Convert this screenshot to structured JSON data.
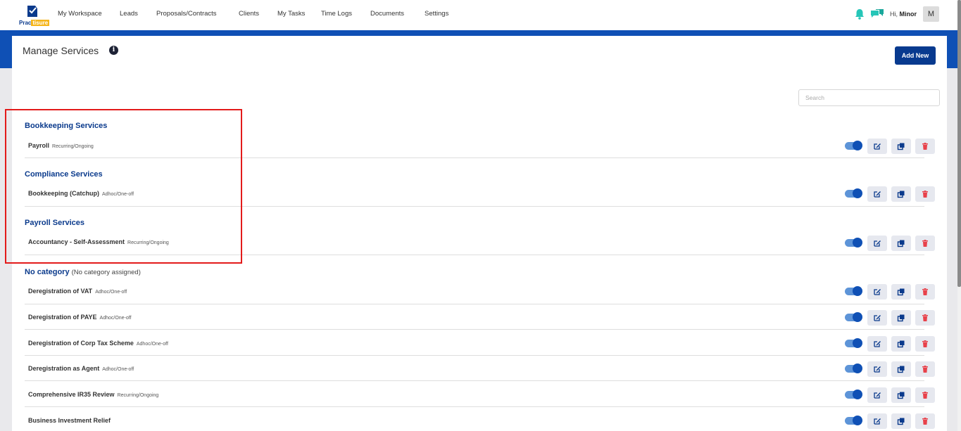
{
  "brand": {
    "logo_text_a": "Prac",
    "logo_text_b": "tisure"
  },
  "nav": {
    "items": [
      "My Workspace",
      "Leads",
      "Proposals/Contracts",
      "Clients",
      "My Tasks",
      "Time Logs",
      "Documents",
      "Settings"
    ]
  },
  "header": {
    "greeting": "Hi, ",
    "user_name": "Minor",
    "avatar_initial": "M"
  },
  "page": {
    "title": "Manage Services",
    "add_new_label": "Add New",
    "search_placeholder": "Search"
  },
  "categories": [
    {
      "name": "Bookkeeping Services",
      "note": "",
      "services": [
        {
          "name": "Payroll",
          "type": "Recurring/Ongoing",
          "enabled": true
        }
      ]
    },
    {
      "name": "Compliance Services",
      "note": "",
      "services": [
        {
          "name": "Bookkeeping (Catchup)",
          "type": "Adhoc/One-off",
          "enabled": true
        }
      ]
    },
    {
      "name": "Payroll Services",
      "note": "",
      "services": [
        {
          "name": "Accountancy - Self-Assessment",
          "type": "Recurring/Ongoing",
          "enabled": true
        }
      ]
    },
    {
      "name": "No category",
      "note": "(No category assigned)",
      "services": [
        {
          "name": "Deregistration of VAT",
          "type": "Adhoc/One-off",
          "enabled": true
        },
        {
          "name": "Deregistration of PAYE",
          "type": "Adhoc/One-off",
          "enabled": true
        },
        {
          "name": "Deregistration of Corp Tax Scheme",
          "type": "Adhoc/One-off",
          "enabled": true
        },
        {
          "name": "Deregistration as Agent",
          "type": "Adhoc/One-off",
          "enabled": true
        },
        {
          "name": "Comprehensive IR35 Review",
          "type": "Recurring/Ongoing",
          "enabled": true
        },
        {
          "name": "Business Investment Relief",
          "type": "",
          "enabled": true
        }
      ]
    }
  ],
  "colors": {
    "accent": "#0f50b5",
    "category_text": "#0a3a8c",
    "delete": "#e8414a",
    "highlight": "#e31b1b"
  },
  "icons": {
    "edit": "edit-icon",
    "duplicate": "duplicate-icon",
    "delete": "trash-icon",
    "notifications": "bell-icon",
    "messages": "chat-icon",
    "info": "info-icon"
  }
}
